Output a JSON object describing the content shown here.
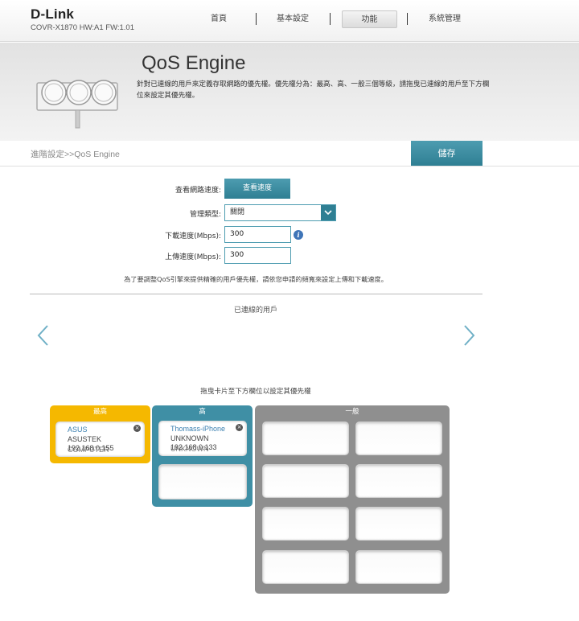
{
  "header": {
    "brand": "D-Link",
    "model_info": "COVR-X1870 HW:A1 FW:1.01",
    "nav": [
      {
        "label": "首頁"
      },
      {
        "label": "基本設定"
      },
      {
        "label": "功能"
      },
      {
        "label": "系統管理"
      }
    ],
    "active_nav": "功能"
  },
  "banner": {
    "title": "QoS Engine",
    "description": "針對已連線的用戶來定義存取網路的優先權。優先權分為：最高、高、一般三個等級，請拖曳已連線的用戶至下方欄位來設定其優先權。"
  },
  "breadcrumb": "進階設定>>QoS Engine",
  "save_label": "儲存",
  "form": {
    "speed_label": "查看網路速度:",
    "speed_button": "查看速度",
    "mgmt_label": "管理類型:",
    "mgmt_value": "關閉",
    "download_label": "下載速度(Mbps):",
    "download_value": "300",
    "upload_label": "上傳速度(Mbps):",
    "upload_value": "300",
    "info_icon": "i",
    "hint": "為了要調整QoS引擎來提供精確的用戶優先權，請依您申請的頻寬來設定上傳和下載速度。"
  },
  "connected_title": "已連線的用戶",
  "drag_hint": "拖曳卡片至下方欄位以設定其優先權",
  "priorities": {
    "highest": {
      "label": "最高",
      "color": "#f5b800",
      "devices": [
        {
          "name": "ASUS",
          "vendor": "ASUSTEK",
          "ip": "192.168.0.155",
          "type": "COMPUTER"
        }
      ]
    },
    "high": {
      "label": "高",
      "color": "#3f8fa5",
      "devices": [
        {
          "name": "Thomass-iPhone",
          "vendor": "UNKNOWN",
          "ip": "192.168.0.133",
          "type": "UNKNOWN"
        }
      ]
    },
    "normal": {
      "label": "一般",
      "color": "#8f8f8f",
      "devices": []
    }
  },
  "colors": {
    "accent": "#2f7f93",
    "highest": "#f5b800",
    "high": "#3f8fa5",
    "normal": "#8f8f8f"
  }
}
